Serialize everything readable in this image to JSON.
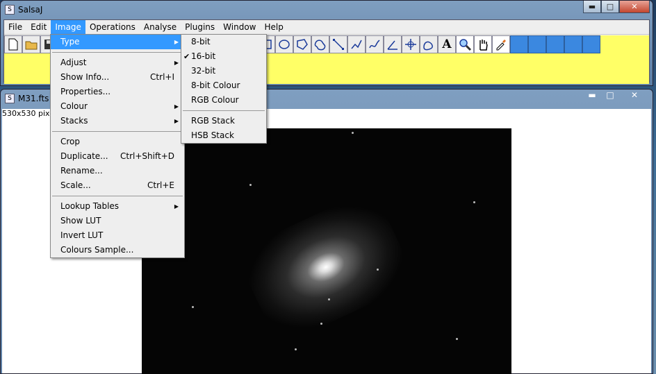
{
  "main_window": {
    "title": "SalsaJ",
    "controls": {
      "minimize": "▬",
      "maximize": "□",
      "close": "✕"
    }
  },
  "menubar": [
    "File",
    "Edit",
    "Image",
    "Operations",
    "Analyse",
    "Plugins",
    "Window",
    "Help"
  ],
  "active_menu": "Image",
  "toolbar": {
    "text_tool_label": "A",
    "icons": [
      "new-file-icon",
      "open-folder-icon",
      "save-icon",
      "rectangle-icon",
      "oval-icon",
      "polygon-icon",
      "freehand-icon",
      "line-icon",
      "segmented-line-icon",
      "freehand-line-icon",
      "angle-icon",
      "crosshair-icon",
      "wand-icon",
      "text-icon",
      "magnifier-icon",
      "hand-icon",
      "dropper-icon"
    ]
  },
  "image_window": {
    "title": "M31.fts",
    "info": "530x530 pixe"
  },
  "image_menu": {
    "items": [
      {
        "label": "Type",
        "submenu": true,
        "active": true
      },
      {
        "separator": true
      },
      {
        "label": "Adjust",
        "submenu": true
      },
      {
        "label": "Show Info...",
        "shortcut": "Ctrl+I"
      },
      {
        "label": "Properties..."
      },
      {
        "label": "Colour",
        "submenu": true
      },
      {
        "label": "Stacks",
        "submenu": true
      },
      {
        "separator": true
      },
      {
        "label": "Crop"
      },
      {
        "label": "Duplicate...",
        "shortcut": "Ctrl+Shift+D"
      },
      {
        "label": "Rename..."
      },
      {
        "label": "Scale...",
        "shortcut": "Ctrl+E"
      },
      {
        "separator": true
      },
      {
        "label": "Lookup Tables",
        "submenu": true
      },
      {
        "label": "Show LUT"
      },
      {
        "label": "Invert LUT"
      },
      {
        "label": "Colours Sample..."
      }
    ]
  },
  "type_submenu": {
    "items": [
      {
        "label": "8-bit"
      },
      {
        "label": "16-bit",
        "checked": true
      },
      {
        "label": "32-bit"
      },
      {
        "label": "8-bit Colour"
      },
      {
        "label": "RGB Colour"
      },
      {
        "separator": true
      },
      {
        "label": "RGB Stack"
      },
      {
        "label": "HSB Stack"
      }
    ]
  },
  "colors": {
    "toolbar_bg": "#ffff66",
    "menu_highlight": "#3399ff"
  }
}
